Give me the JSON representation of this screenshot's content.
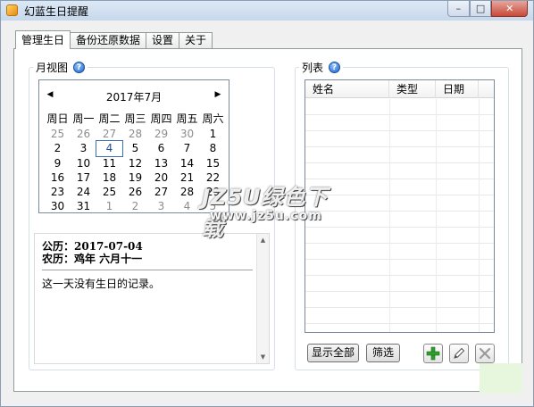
{
  "window": {
    "title": "幻蓝生日提醒"
  },
  "tabs": [
    {
      "label": "管理生日",
      "active": true
    },
    {
      "label": "备份还原数据",
      "active": false
    },
    {
      "label": "设置",
      "active": false
    },
    {
      "label": "关于",
      "active": false
    }
  ],
  "month_view": {
    "caption": "月视图",
    "header": "2017年7月",
    "weekdays": [
      "周日",
      "周一",
      "周二",
      "周三",
      "周四",
      "周五",
      "周六"
    ],
    "weeks": [
      [
        "25",
        "26",
        "27",
        "28",
        "29",
        "30",
        "1"
      ],
      [
        "2",
        "3",
        "4",
        "5",
        "6",
        "7",
        "8"
      ],
      [
        "9",
        "10",
        "11",
        "12",
        "13",
        "14",
        "15"
      ],
      [
        "16",
        "17",
        "18",
        "19",
        "20",
        "21",
        "22"
      ],
      [
        "23",
        "24",
        "25",
        "26",
        "27",
        "28",
        "29"
      ],
      [
        "30",
        "31",
        "1",
        "2",
        "3",
        "4",
        "5"
      ]
    ],
    "selected_day": "4"
  },
  "detail": {
    "solar": "公历：2017-07-04",
    "lunar": "农历：鸡年  六月十一",
    "note": "这一天没有生日的记录。"
  },
  "list": {
    "caption": "列表",
    "columns": [
      "姓名",
      "类型",
      "日期"
    ]
  },
  "buttons": {
    "show_all": "显示全部",
    "filter": "筛选"
  },
  "watermark": {
    "brand": "JZ5U绿色下载",
    "url": "www.jz5u.com"
  },
  "colors": {
    "add": "#2f9e2f",
    "title_bar": "#c7d8ec",
    "close": "#c7493a"
  }
}
